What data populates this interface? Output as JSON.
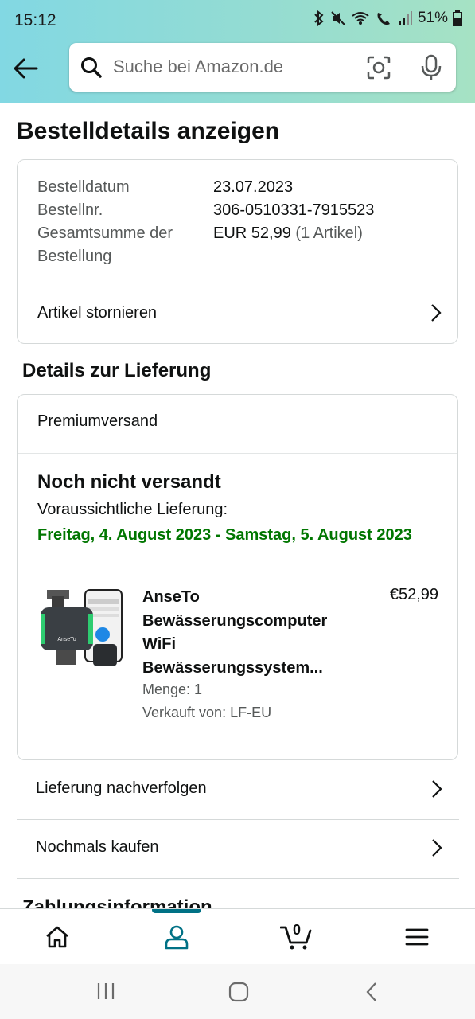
{
  "status_bar": {
    "time": "15:12",
    "battery": "51%"
  },
  "search": {
    "placeholder": "Suche bei Amazon.de"
  },
  "page_title": "Bestelldetails anzeigen",
  "order_summary": {
    "order_date_label": "Bestelldatum",
    "order_date": "23.07.2023",
    "order_number_label": "Bestellnr.",
    "order_number": "306-0510331-7915523",
    "total_label_line1": "Gesamtsumme der",
    "total_label_line2": "Bestellung",
    "total_value": "EUR 52,99",
    "total_items": "(1 Artikel)",
    "cancel_label": "Artikel stornieren"
  },
  "delivery": {
    "section_title": "Details zur Lieferung",
    "shipping_type": "Premiumversand",
    "status": "Noch nicht versandt",
    "expected_label": "Voraussichtliche Lieferung:",
    "expected_date": "Freitag, 4. August 2023 - Samstag, 5. August 2023",
    "product": {
      "name": "AnseTo Bewässerungscomputer WiFi Bewässerungssystem...",
      "price": "€52,99",
      "quantity": "Menge: 1",
      "seller": "Verkauft von: LF-EU",
      "brand_on_image": "AnseTo"
    }
  },
  "actions": {
    "track": "Lieferung nachverfolgen",
    "buy_again": "Nochmals kaufen"
  },
  "next_section_title": "Zahlungsinformation",
  "bottom_nav": {
    "items": [
      "home-icon",
      "account-icon",
      "cart-icon",
      "menu-icon"
    ],
    "active": "account-icon",
    "cart_count": "0"
  },
  "colors": {
    "accent": "#007185",
    "delivery_green": "#007600",
    "header_gradient_start": "#82d8e3",
    "header_gradient_end": "#a6e2c4"
  }
}
